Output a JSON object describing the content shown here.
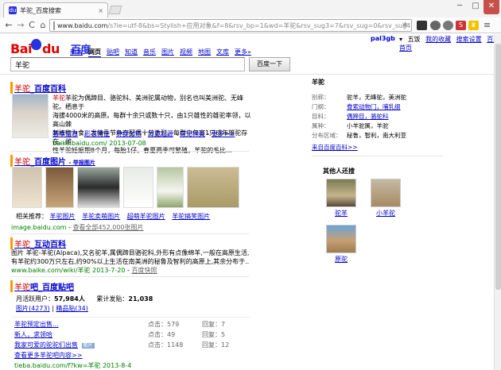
{
  "browser": {
    "tab_title": "羊驼_百度搜索",
    "tab_close": "×",
    "url_host": "www.baidu.com",
    "url_rest": "/s?ie=utf-8&bs=Stylish+应用对象&f=8&rsv_bp=1&wd=羊驼&rsv_sug3=7&rsv_sug=0&rsv_sug4=498&rsv_sug",
    "win_min": "─",
    "win_max": "□",
    "win_close": "✕",
    "back": "←",
    "forward": "→",
    "reload": "C",
    "home": "⌂",
    "star": "★"
  },
  "baidu_top": {
    "user": "pal3gb",
    "links": [
      "▾",
      "五饭",
      "我的收藏",
      "搜索设置",
      "百度首页"
    ]
  },
  "logo": {
    "bai": "Bai",
    "du": "du",
    "cn": "百度"
  },
  "nav_tabs": [
    {
      "label": "新闻"
    },
    {
      "label": "网页"
    },
    {
      "label": "贴吧"
    },
    {
      "label": "知道"
    },
    {
      "label": "音乐"
    },
    {
      "label": "图片"
    },
    {
      "label": "视频"
    },
    {
      "label": "地图"
    },
    {
      "label": "文库"
    },
    {
      "label": "更多»"
    }
  ],
  "search": {
    "query": "羊驼",
    "button": "百度一下"
  },
  "results": {
    "baike": {
      "title_kw": "羊驼",
      "title_rest": "_百度百科",
      "lines": [
        "羊驼为偶蹄目、骆驼科、美洲驼属动物，别名也叫美洲驼、无峰驼。栖息于",
        "海拔4000米的高原。每群十余只或数十只，由1只雄性的雄驼率领，以高山棘",
        "刺植物为食。发情季节争夺配偶十分激烈。每群中仅容1只成年雄驼存在。雌",
        "性羊驼妊娠期8个月，每胎1仔。春夏两季可繁殖。羊驼的毛比..."
      ],
      "links": [
        "基本信息",
        "形态特征",
        "种群分布",
        "历史起源",
        "常见种类",
        "更多>>"
      ],
      "url": "baike.baidu.com/",
      "date": "2013-07-08"
    },
    "images": {
      "title_kw": "羊驼",
      "title_rest": "_百度图片",
      "tag": "- 举报图片",
      "rec_label": "相关推荐：",
      "rec": [
        "羊驼图片",
        "羊驼卖萌图片",
        "超萌羊驼图片",
        "羊驼搞笑图片"
      ],
      "url": "image.baidu.com",
      "count": "查看全部452,000张图片"
    },
    "hudong": {
      "title_kw": "羊驼",
      "title_rest": "_互动百科",
      "lines": [
        "图片 羊驼-羊驼(Alpaca),又名驼羊,属偶蹄目骆驼科,外形有点像绵羊,一般在高原生活,世界现",
        "有羊驼约300万只左右,约90%以上生活在南美洲的秘鲁及智利的高原上,其余分布于..."
      ],
      "url": "www.baike.com/wiki/羊驼",
      "date": "2013-7-20",
      "cache": "百度快照"
    },
    "tieba": {
      "title_kw": "羊驼",
      "title_rest": "吧_百度贴吧",
      "stats_a_label": "月活跃用户：",
      "stats_a": "57,984人",
      "stats_b_label": "累计发贴：",
      "stats_b": "21,038",
      "sub_links": [
        "图片(4273)",
        "精品贴(34)"
      ],
      "rows": [
        {
          "title": "羊驼预定出售...",
          "clicks": "点击：579",
          "replies": "回复：7"
        },
        {
          "title": "新人，求领哈",
          "clicks": "点击：49",
          "replies": "回复：5"
        },
        {
          "title": "我家可爱的驼驼们出售",
          "clicks": "点击：1148",
          "replies": "回复：12"
        },
        {
          "title": "查看更多羊驼吧内容>>",
          "clicks": "",
          "replies": ""
        }
      ],
      "url": "tieba.baidu.com/f?kw=羊驼",
      "date": "2013-8-4"
    }
  },
  "sidebar": {
    "heading": "羊驼",
    "facts": [
      {
        "k": "别称：",
        "v": "驼羊，无峰驼，美洲驼"
      },
      {
        "k": "门纲：",
        "v": "脊索动物门，哺乳纲"
      },
      {
        "k": "目科：",
        "v": "偶蹄目，骆驼科"
      },
      {
        "k": "属种：",
        "v": "小羊驼属，羊驼"
      },
      {
        "k": "分布区域：",
        "v": "秘鲁，智利，南大利亚"
      }
    ],
    "source": "来自百度百科>>",
    "also_heading": "其他人还搜",
    "also": [
      {
        "label": "驼羊"
      },
      {
        "label": "小羊驼"
      },
      {
        "label": "原驼"
      }
    ]
  }
}
